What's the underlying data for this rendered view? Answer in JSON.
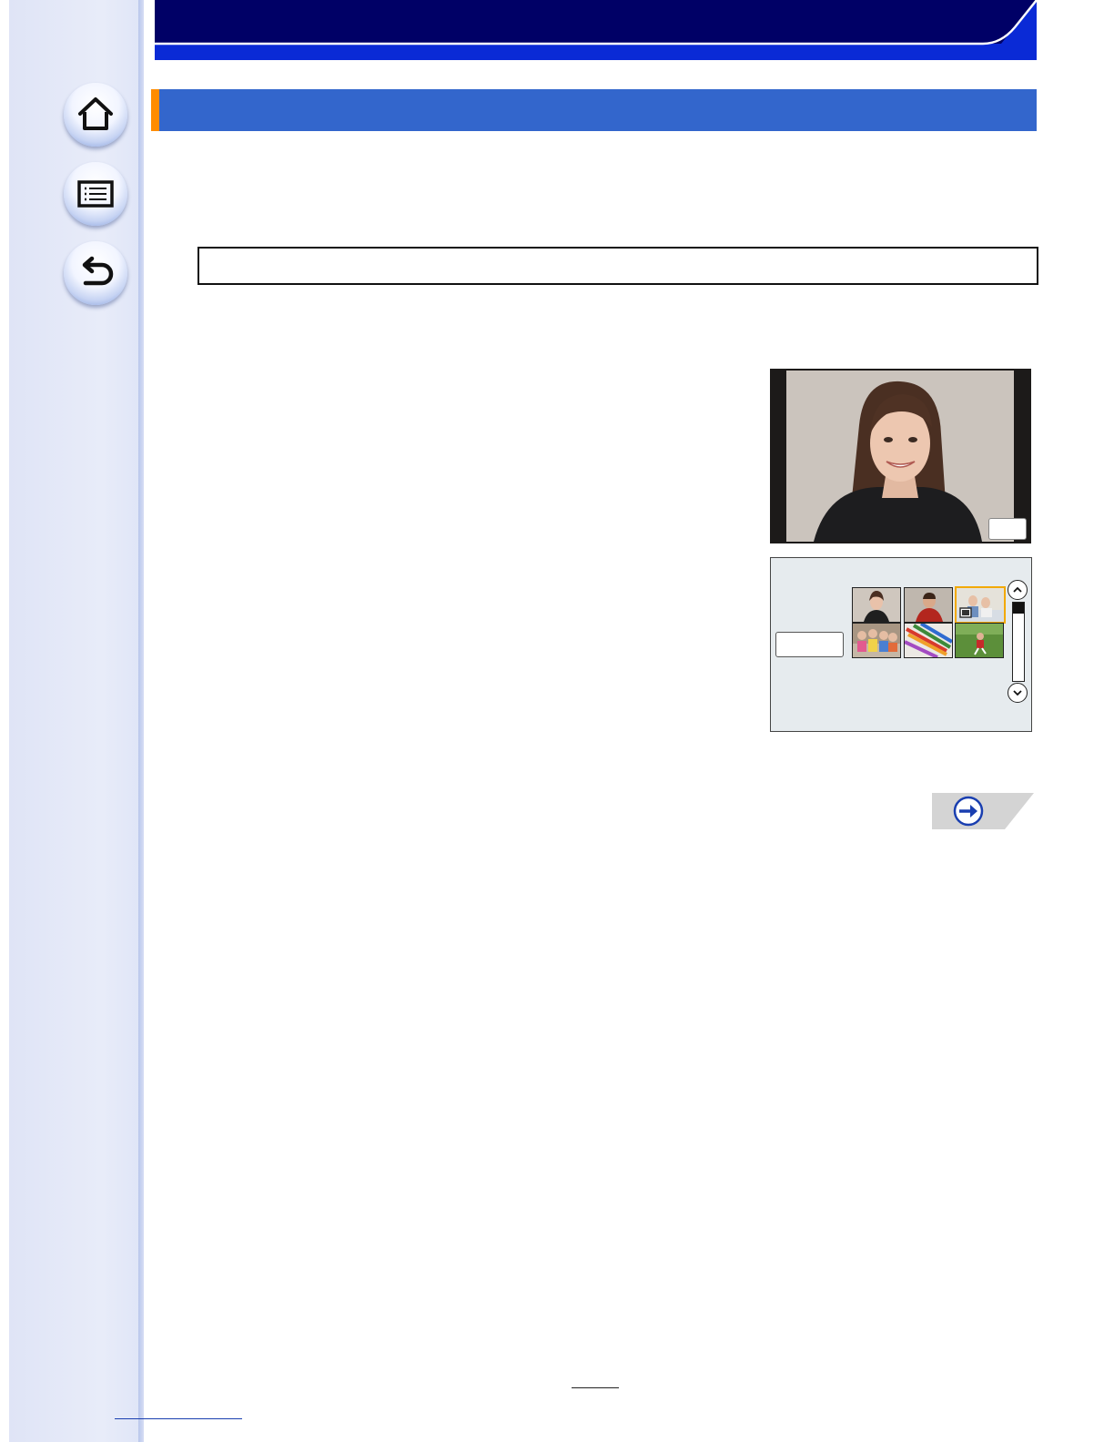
{
  "colors": {
    "header_band": "#000066",
    "header_stripe": "#0a2ad6",
    "section_bar": "#3366cc",
    "section_accent": "#ff8c00",
    "sidebar": "#e4e8f8",
    "selected_thumb_border": "#f2a900"
  },
  "sidebar": {
    "buttons": [
      {
        "icon": "home-icon"
      },
      {
        "icon": "contents-list-icon"
      },
      {
        "icon": "back-arrow-icon"
      }
    ]
  },
  "thumbnail_screen": {
    "thumbnails": [
      {
        "icon": "portrait-woman-thumb",
        "selected": false
      },
      {
        "icon": "portrait-boy-thumb",
        "selected": false
      },
      {
        "icon": "family-thumb",
        "selected": true
      },
      {
        "icon": "children-group-thumb",
        "selected": false
      },
      {
        "icon": "colored-pencils-thumb",
        "selected": false
      },
      {
        "icon": "soccer-field-thumb",
        "selected": false
      }
    ],
    "scroll_position": 0
  },
  "next_page": {
    "icon": "right-arrow-icon"
  }
}
